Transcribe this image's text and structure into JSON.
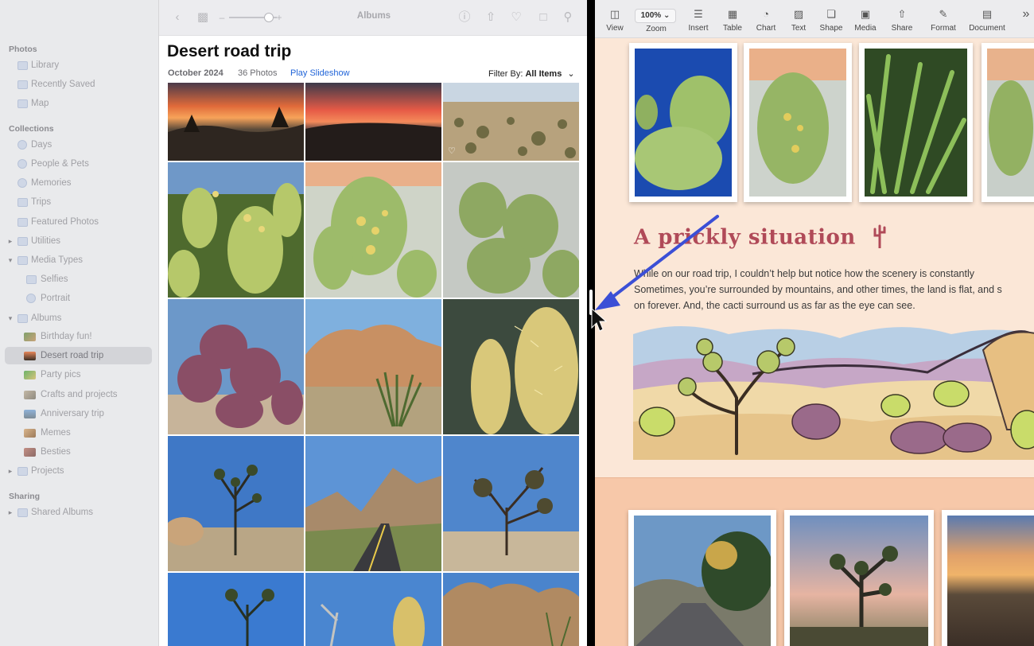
{
  "photos": {
    "toolbar": {
      "title": "Albums"
    },
    "sidebar": {
      "sections": [
        {
          "label": "Photos",
          "items": [
            {
              "label": "Library",
              "icon": "photo-library-icon"
            },
            {
              "label": "Recently Saved",
              "icon": "recently-saved-icon"
            },
            {
              "label": "Map",
              "icon": "map-icon"
            }
          ]
        },
        {
          "label": "Collections",
          "items": [
            {
              "label": "Days",
              "icon": "days-icon"
            },
            {
              "label": "People & Pets",
              "icon": "people-icon"
            },
            {
              "label": "Memories",
              "icon": "memories-icon"
            },
            {
              "label": "Trips",
              "icon": "trips-icon"
            },
            {
              "label": "Featured Photos",
              "icon": "featured-photos-icon"
            },
            {
              "label": "Utilities",
              "icon": "utilities-icon"
            },
            {
              "label": "Media Types",
              "icon": "media-types-icon"
            },
            {
              "label": "Selfies",
              "icon": "selfies-icon"
            },
            {
              "label": "Portrait",
              "icon": "portrait-icon"
            },
            {
              "label": "Albums",
              "icon": "albums-icon"
            },
            {
              "label": "Birthday fun!",
              "icon": "album-thumb"
            },
            {
              "label": "Desert road trip",
              "icon": "album-thumb"
            },
            {
              "label": "Party pics",
              "icon": "album-thumb"
            },
            {
              "label": "Crafts and projects",
              "icon": "album-thumb"
            },
            {
              "label": "Anniversary trip",
              "icon": "album-thumb"
            },
            {
              "label": "Memes",
              "icon": "album-thumb"
            },
            {
              "label": "Besties",
              "icon": "album-thumb"
            },
            {
              "label": "Projects",
              "icon": "projects-icon"
            }
          ]
        },
        {
          "label": "Sharing",
          "items": [
            {
              "label": "Shared Albums",
              "icon": "shared-albums-icon"
            }
          ]
        }
      ]
    },
    "album": {
      "title": "Desert road trip",
      "date": "October 2024",
      "count": "36 Photos",
      "slideshow": "Play Slideshow",
      "filter_label": "Filter By:",
      "filter_value": "All Items"
    }
  },
  "pages": {
    "toolbar": {
      "view": "View",
      "zoom_value": "100%",
      "zoom": "Zoom",
      "insert": "Insert",
      "table": "Table",
      "chart": "Chart",
      "text": "Text",
      "shape": "Shape",
      "media": "Media",
      "share": "Share",
      "format": "Format",
      "document": "Document"
    },
    "document": {
      "heading": "A prickly situation",
      "body_lines": [
        "While on our road trip, I couldn’t help but notice how the scenery is constantly",
        "Sometimes, you’re surrounded by mountains, and other times, the land is flat, and s",
        "on forever. And, the cacti surround us as far as the eye can see."
      ]
    }
  },
  "colors": {
    "accent_link": "#1f63d8",
    "heading": "#b04a58",
    "arrow": "#3b4fd6"
  }
}
